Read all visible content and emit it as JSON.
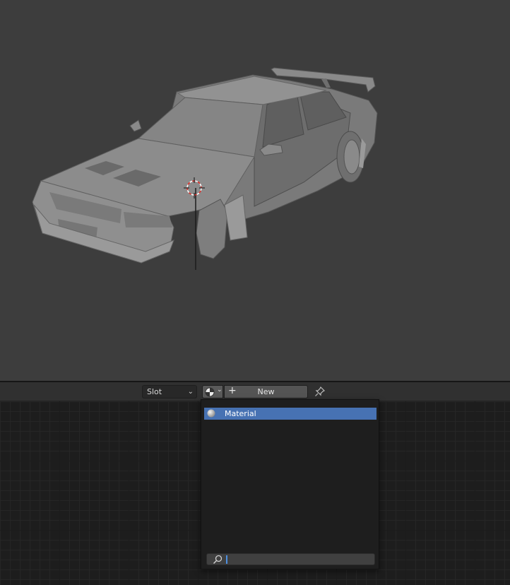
{
  "header": {
    "slot_label": "Slot",
    "new_label": "New"
  },
  "material_menu": {
    "items": [
      {
        "label": "Material",
        "selected": true
      }
    ],
    "search": {
      "value": ""
    }
  },
  "colors": {
    "viewport_bg": "#3d3d3d",
    "header_bg": "#303030",
    "highlight": "#4772b3",
    "node_bg": "#1d1d1d"
  },
  "icons": [
    "cursor-3d-icon",
    "material-ball-icon",
    "chevron-down-icon",
    "plus-icon",
    "pin-icon",
    "search-icon"
  ]
}
